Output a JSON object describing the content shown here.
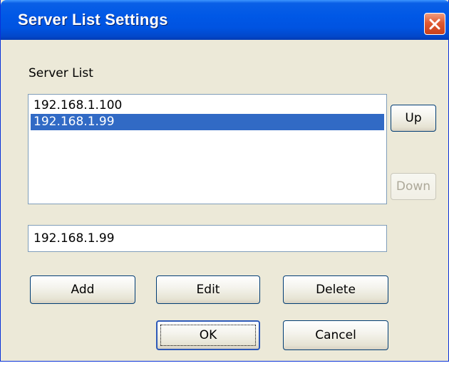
{
  "window": {
    "title": "Server List Settings"
  },
  "server_list": {
    "label": "Server List",
    "items": [
      {
        "text": "192.168.1.100",
        "selected": false
      },
      {
        "text": "192.168.1.99",
        "selected": true
      }
    ]
  },
  "buttons": {
    "up": "Up",
    "down": "Down",
    "add": "Add",
    "edit": "Edit",
    "delete": "Delete",
    "ok": "OK",
    "cancel": "Cancel"
  },
  "server_input": {
    "value": "192.168.1.99"
  },
  "icons": {
    "close": "close-icon"
  },
  "colors": {
    "titlebar": "#0058e6",
    "selection": "#316ac5",
    "close_button": "#e05a32",
    "dialog_bg": "#ece9d8"
  }
}
